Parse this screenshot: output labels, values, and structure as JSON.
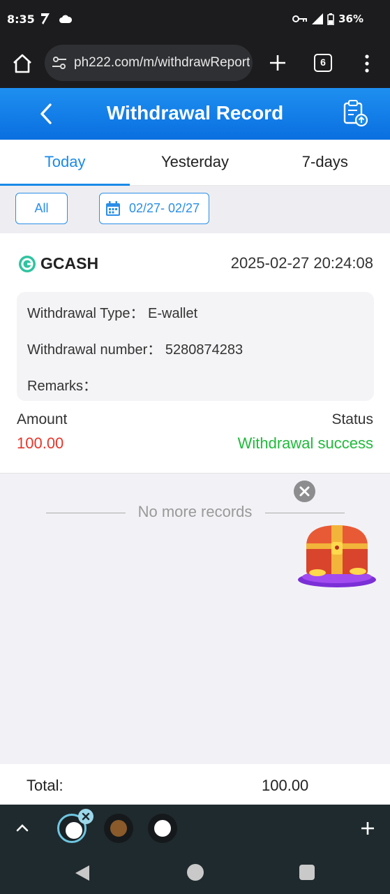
{
  "status_bar": {
    "time": "8:35",
    "battery": "36%"
  },
  "browser": {
    "url": "ph222.com/m/withdrawReport",
    "tab_count": "6"
  },
  "header": {
    "title": "Withdrawal Record"
  },
  "tabs": [
    {
      "label": "Today",
      "active": true
    },
    {
      "label": "Yesterday",
      "active": false
    },
    {
      "label": "7-days",
      "active": false
    }
  ],
  "filters": {
    "type_label": "All",
    "date_range": "02/27- 02/27"
  },
  "record": {
    "method": "GCASH",
    "datetime": "2025-02-27 20:24:08",
    "type_label": "Withdrawal Type：",
    "type_value": "E-wallet",
    "number_label": "Withdrawal number：",
    "number_value": "5280874283",
    "remarks_label": "Remarks：",
    "amount_label": "Amount",
    "amount_value": "100.00",
    "status_label": "Status",
    "status_value": "Withdrawal success"
  },
  "footer_note": "No more records",
  "total": {
    "label": "Total:",
    "value": "100.00"
  },
  "colors": {
    "header_blue": "#1a8ae8",
    "amount_red": "#e8352a",
    "status_green": "#1fba3a"
  }
}
